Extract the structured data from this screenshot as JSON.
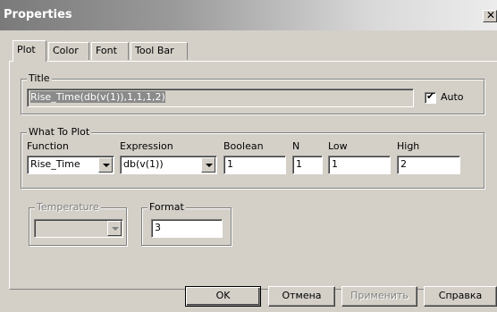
{
  "window": {
    "title": "Properties",
    "close_glyph": "✕"
  },
  "tabs": [
    {
      "label": "Plot",
      "active": true
    },
    {
      "label": "Color",
      "active": false
    },
    {
      "label": "Font",
      "active": false
    },
    {
      "label": "Tool Bar",
      "active": false
    }
  ],
  "title_group": {
    "label": "Title",
    "value": "Rise_Time(db(v(1)),1,1,1,2)",
    "auto_label": "Auto",
    "auto_checked": true
  },
  "what_to_plot": {
    "label": "What To Plot",
    "function_label": "Function",
    "function_value": "Rise_Time",
    "expression_label": "Expression",
    "expression_value": "db(v(1))",
    "boolean_label": "Boolean",
    "boolean_value": "1",
    "n_label": "N",
    "n_value": "1",
    "low_label": "Low",
    "low_value": "1",
    "high_label": "High",
    "high_value": "2"
  },
  "temperature": {
    "label": "Temperature",
    "value": ""
  },
  "format": {
    "label": "Format",
    "value": "3"
  },
  "buttons": {
    "ok": "OK",
    "cancel": "Отмена",
    "apply": "Применить",
    "help": "Справка"
  },
  "icons": {
    "checkmark": "✔",
    "dropdown": "chevron-down-icon"
  }
}
